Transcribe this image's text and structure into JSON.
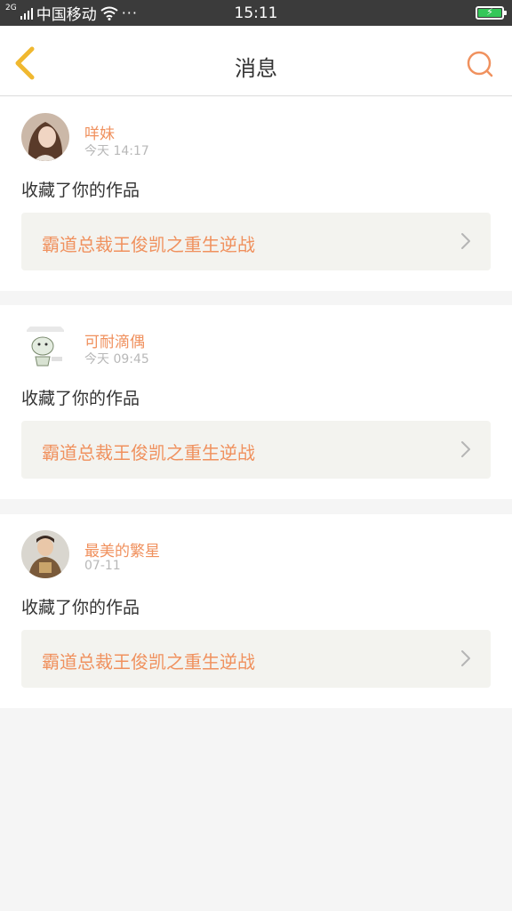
{
  "status_bar": {
    "network_type": "2G",
    "carrier": "中国移动",
    "more": "···",
    "time": "15:11",
    "battery_level": 1.0,
    "battery_color": "#34c759",
    "icons": [
      "signal-icon",
      "wifi-icon",
      "battery-icon"
    ]
  },
  "header": {
    "title": "消息",
    "back_icon": "chevron-left-icon",
    "search_icon": "search-icon",
    "accent_color": "#f0b830",
    "search_color": "#f0915e"
  },
  "messages": [
    {
      "username": "咩妹",
      "time": "今天 14:17",
      "text": "收藏了你的作品",
      "work_title": "霸道总裁王俊凯之重生逆战",
      "avatar": "photo-avatar-icon"
    },
    {
      "username": "可耐滴偶",
      "time": "今天 09:45",
      "text": "收藏了你的作品",
      "work_title": "霸道总裁王俊凯之重生逆战",
      "avatar": "cartoon-avatar-icon"
    },
    {
      "username": "最美的繁星",
      "time": "07-11",
      "text": "收藏了你的作品",
      "work_title": "霸道总裁王俊凯之重生逆战",
      "avatar": "photo-avatar-icon"
    }
  ],
  "colors": {
    "accent_orange": "#f0915e",
    "link_bg": "#f3f3ef",
    "page_bg": "#f5f5f5"
  }
}
